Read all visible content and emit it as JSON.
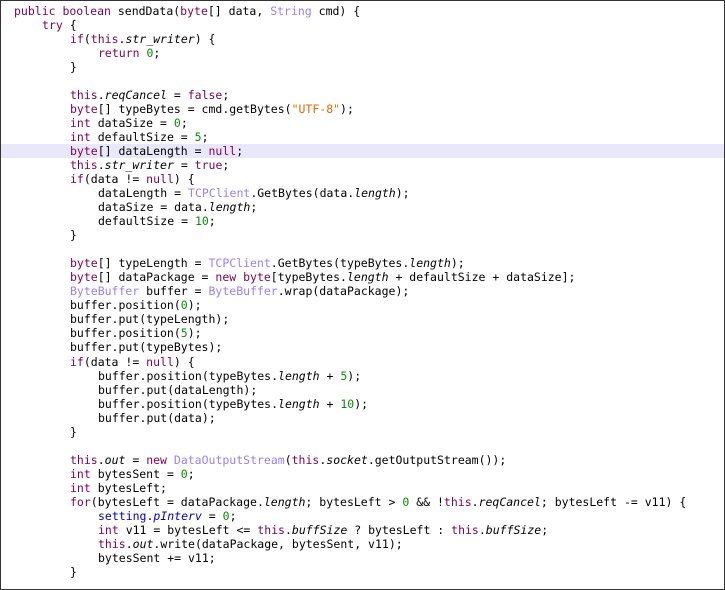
{
  "editor": {
    "highlighted_line": 11,
    "colors": {
      "keyword": "#7f0055",
      "type": "#9a7ff5",
      "number": "#098b09",
      "string": "#e06a00",
      "static": "#0000c0",
      "highlight": "#e8e8fa"
    },
    "lines": [
      {
        "i": 0,
        "tok": [
          [
            "k",
            "public boolean "
          ],
          [
            "p",
            "sendData("
          ],
          [
            "k",
            "byte"
          ],
          [
            "p",
            "[] data, "
          ],
          [
            "t",
            "String"
          ],
          [
            "p",
            " cmd) {"
          ]
        ]
      },
      {
        "i": 1,
        "tok": [
          [
            "k",
            "try"
          ],
          [
            "p",
            " {"
          ]
        ]
      },
      {
        "i": 2,
        "tok": [
          [
            "k",
            "if"
          ],
          [
            "p",
            "("
          ],
          [
            "k",
            "this"
          ],
          [
            "p",
            "."
          ],
          [
            "f",
            "str_writer"
          ],
          [
            "p",
            ") {"
          ]
        ]
      },
      {
        "i": 3,
        "tok": [
          [
            "k",
            "return "
          ],
          [
            "n",
            "0"
          ],
          [
            "p",
            ";"
          ]
        ]
      },
      {
        "i": 2,
        "tok": [
          [
            "p",
            "}"
          ]
        ]
      },
      {
        "i": 0,
        "tok": []
      },
      {
        "i": 2,
        "tok": [
          [
            "k",
            "this"
          ],
          [
            "p",
            "."
          ],
          [
            "f",
            "reqCancel"
          ],
          [
            "p",
            " = "
          ],
          [
            "k",
            "false"
          ],
          [
            "p",
            ";"
          ]
        ]
      },
      {
        "i": 2,
        "tok": [
          [
            "k",
            "byte"
          ],
          [
            "p",
            "[] typeBytes = cmd.getBytes("
          ],
          [
            "s",
            "\"UTF-8\""
          ],
          [
            "p",
            ");"
          ]
        ]
      },
      {
        "i": 2,
        "tok": [
          [
            "k",
            "int"
          ],
          [
            "p",
            " dataSize = "
          ],
          [
            "n",
            "0"
          ],
          [
            "p",
            ";"
          ]
        ]
      },
      {
        "i": 2,
        "tok": [
          [
            "k",
            "int"
          ],
          [
            "p",
            " defaultSize = "
          ],
          [
            "n",
            "5"
          ],
          [
            "p",
            ";"
          ]
        ]
      },
      {
        "i": 2,
        "tok": [
          [
            "k",
            "byte"
          ],
          [
            "p",
            "[] dataLength = "
          ],
          [
            "k",
            "null"
          ],
          [
            "p",
            ";"
          ]
        ]
      },
      {
        "i": 2,
        "tok": [
          [
            "k",
            "this"
          ],
          [
            "p",
            "."
          ],
          [
            "f",
            "str_writer"
          ],
          [
            "p",
            " = "
          ],
          [
            "k",
            "true"
          ],
          [
            "p",
            ";"
          ]
        ]
      },
      {
        "i": 2,
        "tok": [
          [
            "k",
            "if"
          ],
          [
            "p",
            "(data != "
          ],
          [
            "k",
            "null"
          ],
          [
            "p",
            ") {"
          ]
        ]
      },
      {
        "i": 3,
        "tok": [
          [
            "p",
            "dataLength = "
          ],
          [
            "t",
            "TCPClient"
          ],
          [
            "p",
            ".GetBytes(data."
          ],
          [
            "f",
            "length"
          ],
          [
            "p",
            ");"
          ]
        ]
      },
      {
        "i": 3,
        "tok": [
          [
            "p",
            "dataSize = data."
          ],
          [
            "f",
            "length"
          ],
          [
            "p",
            ";"
          ]
        ]
      },
      {
        "i": 3,
        "tok": [
          [
            "p",
            "defaultSize = "
          ],
          [
            "n",
            "10"
          ],
          [
            "p",
            ";"
          ]
        ]
      },
      {
        "i": 2,
        "tok": [
          [
            "p",
            "}"
          ]
        ]
      },
      {
        "i": 0,
        "tok": []
      },
      {
        "i": 2,
        "tok": [
          [
            "k",
            "byte"
          ],
          [
            "p",
            "[] typeLength = "
          ],
          [
            "t",
            "TCPClient"
          ],
          [
            "p",
            ".GetBytes(typeBytes."
          ],
          [
            "f",
            "length"
          ],
          [
            "p",
            ");"
          ]
        ]
      },
      {
        "i": 2,
        "tok": [
          [
            "k",
            "byte"
          ],
          [
            "p",
            "[] dataPackage = "
          ],
          [
            "k",
            "new byte"
          ],
          [
            "p",
            "[typeBytes."
          ],
          [
            "f",
            "length"
          ],
          [
            "p",
            " + defaultSize + dataSize];"
          ]
        ]
      },
      {
        "i": 2,
        "tok": [
          [
            "t",
            "ByteBuffer"
          ],
          [
            "p",
            " buffer = "
          ],
          [
            "t",
            "ByteBuffer"
          ],
          [
            "p",
            ".wrap(dataPackage);"
          ]
        ]
      },
      {
        "i": 2,
        "tok": [
          [
            "p",
            "buffer.position("
          ],
          [
            "n",
            "0"
          ],
          [
            "p",
            ");"
          ]
        ]
      },
      {
        "i": 2,
        "tok": [
          [
            "p",
            "buffer.put(typeLength);"
          ]
        ]
      },
      {
        "i": 2,
        "tok": [
          [
            "p",
            "buffer.position("
          ],
          [
            "n",
            "5"
          ],
          [
            "p",
            ");"
          ]
        ]
      },
      {
        "i": 2,
        "tok": [
          [
            "p",
            "buffer.put(typeBytes);"
          ]
        ]
      },
      {
        "i": 2,
        "tok": [
          [
            "k",
            "if"
          ],
          [
            "p",
            "(data != "
          ],
          [
            "k",
            "null"
          ],
          [
            "p",
            ") {"
          ]
        ]
      },
      {
        "i": 3,
        "tok": [
          [
            "p",
            "buffer.position(typeBytes."
          ],
          [
            "f",
            "length"
          ],
          [
            "p",
            " + "
          ],
          [
            "n",
            "5"
          ],
          [
            "p",
            ");"
          ]
        ]
      },
      {
        "i": 3,
        "tok": [
          [
            "p",
            "buffer.put(dataLength);"
          ]
        ]
      },
      {
        "i": 3,
        "tok": [
          [
            "p",
            "buffer.position(typeBytes."
          ],
          [
            "f",
            "length"
          ],
          [
            "p",
            " + "
          ],
          [
            "n",
            "10"
          ],
          [
            "p",
            ");"
          ]
        ]
      },
      {
        "i": 3,
        "tok": [
          [
            "p",
            "buffer.put(data);"
          ]
        ]
      },
      {
        "i": 2,
        "tok": [
          [
            "p",
            "}"
          ]
        ]
      },
      {
        "i": 0,
        "tok": []
      },
      {
        "i": 2,
        "tok": [
          [
            "k",
            "this"
          ],
          [
            "p",
            "."
          ],
          [
            "f",
            "out"
          ],
          [
            "p",
            " = "
          ],
          [
            "k",
            "new "
          ],
          [
            "t",
            "DataOutputStream"
          ],
          [
            "p",
            "("
          ],
          [
            "k",
            "this"
          ],
          [
            "p",
            "."
          ],
          [
            "f",
            "socket"
          ],
          [
            "p",
            ".getOutputStream());"
          ]
        ]
      },
      {
        "i": 2,
        "tok": [
          [
            "k",
            "int"
          ],
          [
            "p",
            " bytesSent = "
          ],
          [
            "n",
            "0"
          ],
          [
            "p",
            ";"
          ]
        ]
      },
      {
        "i": 2,
        "tok": [
          [
            "k",
            "int"
          ],
          [
            "p",
            " bytesLeft;"
          ]
        ]
      },
      {
        "i": 2,
        "tok": [
          [
            "k",
            "for"
          ],
          [
            "p",
            "(bytesLeft = dataPackage."
          ],
          [
            "f",
            "length"
          ],
          [
            "p",
            "; bytesLeft > "
          ],
          [
            "n",
            "0"
          ],
          [
            "p",
            " && !"
          ],
          [
            "k",
            "this"
          ],
          [
            "p",
            "."
          ],
          [
            "f",
            "reqCancel"
          ],
          [
            "p",
            "; bytesLeft -= v11) {"
          ]
        ]
      },
      {
        "i": 3,
        "tok": [
          [
            "g",
            "setting"
          ],
          [
            "p",
            "."
          ],
          [
            "gi",
            "pInterv"
          ],
          [
            "p",
            " = "
          ],
          [
            "n",
            "0"
          ],
          [
            "p",
            ";"
          ]
        ]
      },
      {
        "i": 3,
        "tok": [
          [
            "k",
            "int"
          ],
          [
            "p",
            " v11 = bytesLeft <= "
          ],
          [
            "k",
            "this"
          ],
          [
            "p",
            "."
          ],
          [
            "f",
            "buffSize"
          ],
          [
            "p",
            " ? bytesLeft : "
          ],
          [
            "k",
            "this"
          ],
          [
            "p",
            "."
          ],
          [
            "f",
            "buffSize"
          ],
          [
            "p",
            ";"
          ]
        ]
      },
      {
        "i": 3,
        "tok": [
          [
            "k",
            "this"
          ],
          [
            "p",
            "."
          ],
          [
            "f",
            "out"
          ],
          [
            "p",
            ".write(dataPackage, bytesSent, v11);"
          ]
        ]
      },
      {
        "i": 3,
        "tok": [
          [
            "p",
            "bytesSent += v11;"
          ]
        ]
      },
      {
        "i": 2,
        "tok": [
          [
            "p",
            "}"
          ]
        ]
      }
    ]
  }
}
